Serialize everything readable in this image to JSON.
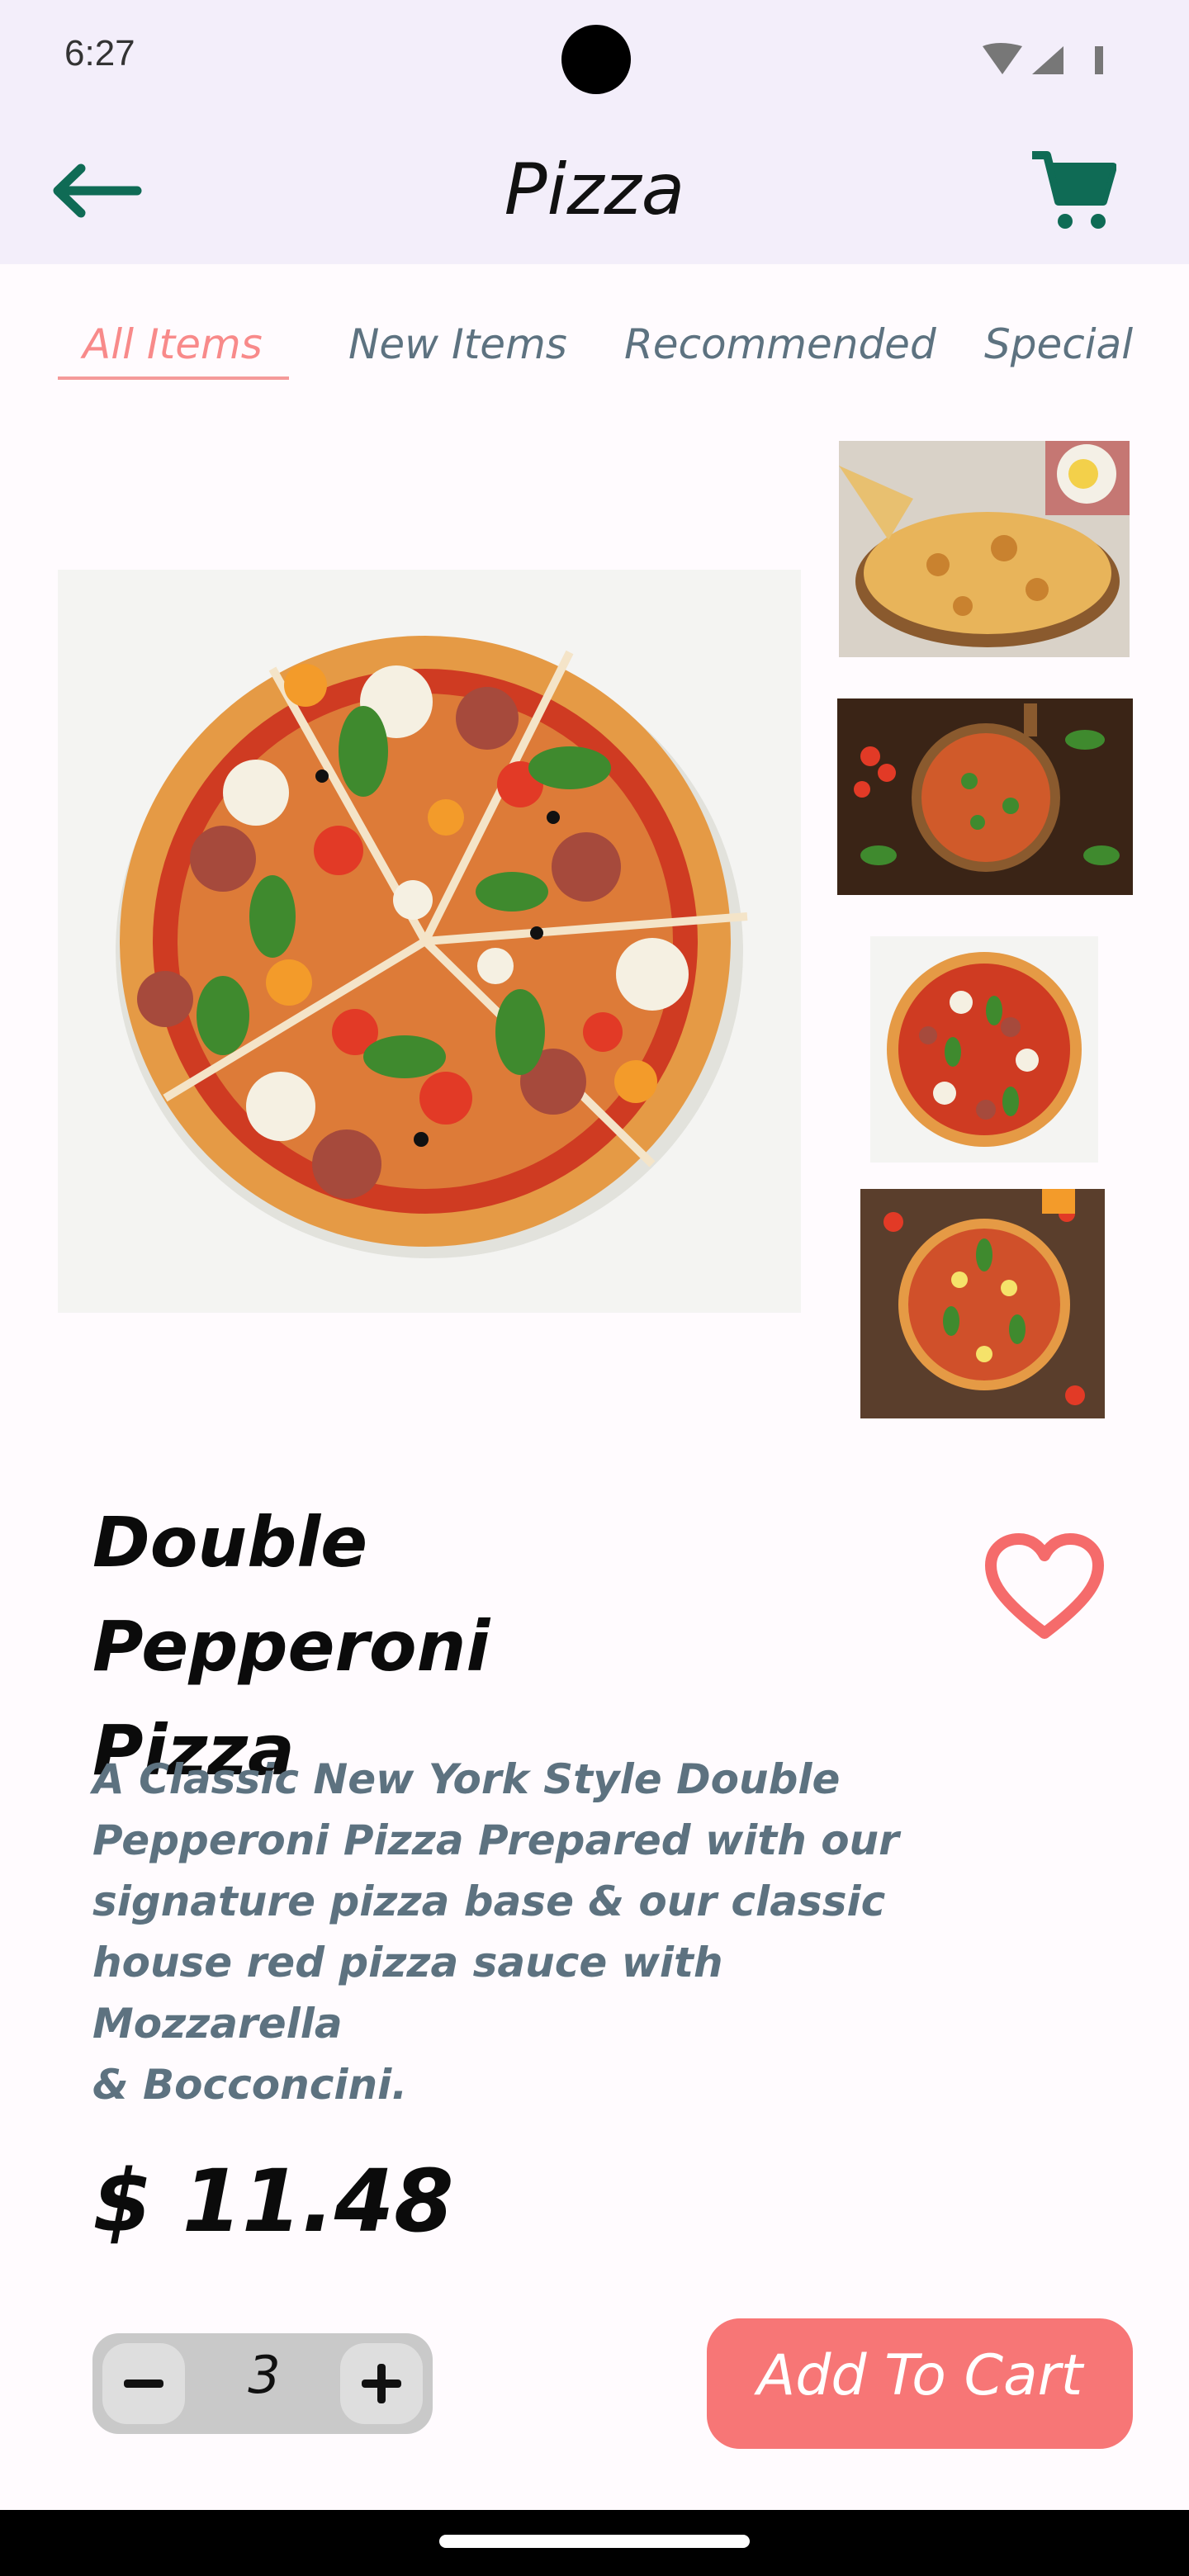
{
  "status_bar": {
    "time": "6:27"
  },
  "header": {
    "title": "Pizza"
  },
  "tabs": [
    {
      "label": "All Items",
      "active": true
    },
    {
      "label": "New Items",
      "active": false
    },
    {
      "label": "Recommended",
      "active": false
    },
    {
      "label": "Special",
      "active": false
    }
  ],
  "product": {
    "name_line1": "Double Pepperoni",
    "name_line2": "Pizza",
    "description_lines": [
      "A Classic New York Style Double",
      "Pepperoni Pizza Prepared with our",
      "signature pizza base & our classic",
      "house red pizza sauce with Mozzarella",
      "& Bocconcini."
    ],
    "price": "$ 11.48",
    "quantity": "3"
  },
  "actions": {
    "add_to_cart_label": "Add To Cart"
  },
  "colors": {
    "accent": "#f77676",
    "tab_active": "#f88a8a",
    "muted_text": "#5d7280",
    "icon_green": "#0f6b55",
    "bar_bg": "#f3eefa"
  },
  "icons": {
    "back": "arrow-left-icon",
    "cart": "cart-icon",
    "favorite": "heart-icon",
    "decrement": "minus-icon",
    "increment": "plus-icon"
  }
}
